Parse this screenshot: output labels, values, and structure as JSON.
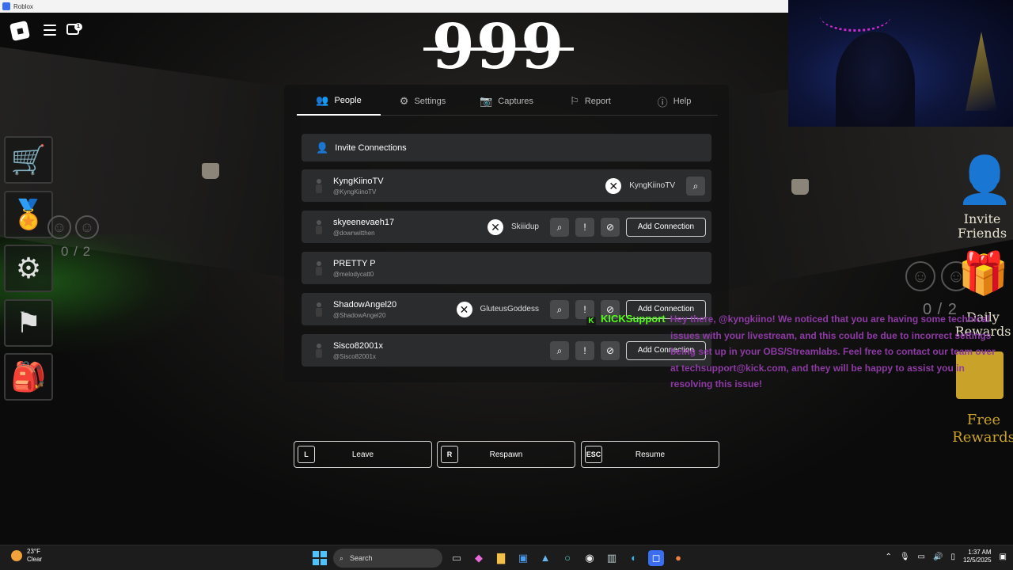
{
  "window": {
    "title": "Roblox"
  },
  "game": {
    "title": "999",
    "chat_badge": "1",
    "left_count": "0 / 2",
    "right_count": "0 / 2",
    "invite_friends": "Invite Friends",
    "daily_rewards": "Daily Rewards",
    "free_rewards": "Free Rewards"
  },
  "menu": {
    "tabs": [
      {
        "label": "People",
        "icon": "people-icon"
      },
      {
        "label": "Settings",
        "icon": "gear-icon"
      },
      {
        "label": "Captures",
        "icon": "camera-icon"
      },
      {
        "label": "Report",
        "icon": "flag-icon"
      },
      {
        "label": "Help",
        "icon": "help-icon"
      }
    ],
    "invite_label": "Invite Connections",
    "players": [
      {
        "display": "KyngKiinoTV",
        "username": "@KyngKiinoTV",
        "gamertag": "KyngKiinoTV",
        "add": ""
      },
      {
        "display": "skyeenevaeh17",
        "username": "@downwitthen",
        "gamertag": "Skiiidup",
        "add": "Add Connection"
      },
      {
        "display": "PRETTY P",
        "username": "@melodycatt0",
        "gamertag": "",
        "add": ""
      },
      {
        "display": "ShadowAngel20",
        "username": "@ShadowAngel20",
        "gamertag": "GluteusGoddess",
        "add": "Add Connection"
      },
      {
        "display": "Sisco82001x",
        "username": "@Sisco82001x",
        "gamertag": "",
        "add": "Add Connection"
      }
    ],
    "buttons": [
      {
        "key": "L",
        "label": "Leave"
      },
      {
        "key": "R",
        "label": "Respawn"
      },
      {
        "key": "ESC",
        "label": "Resume"
      }
    ]
  },
  "chat_overlay": {
    "user": "KICKSupport",
    "message_line1": "Hey there, @kyngkiino! We noticed that you are having some technical",
    "message_rest": "issues with your livestream, and this could be due to incorrect settings being set up in your OBS/Streamlabs. Feel free to contact our team over at techsupport@kick.com, and they will be happy to assist you in resolving this issue!"
  },
  "taskbar": {
    "temperature": "23°F",
    "condition": "Clear",
    "search_placeholder": "Search",
    "time": "1:37 AM",
    "date": "12/5/2025"
  }
}
